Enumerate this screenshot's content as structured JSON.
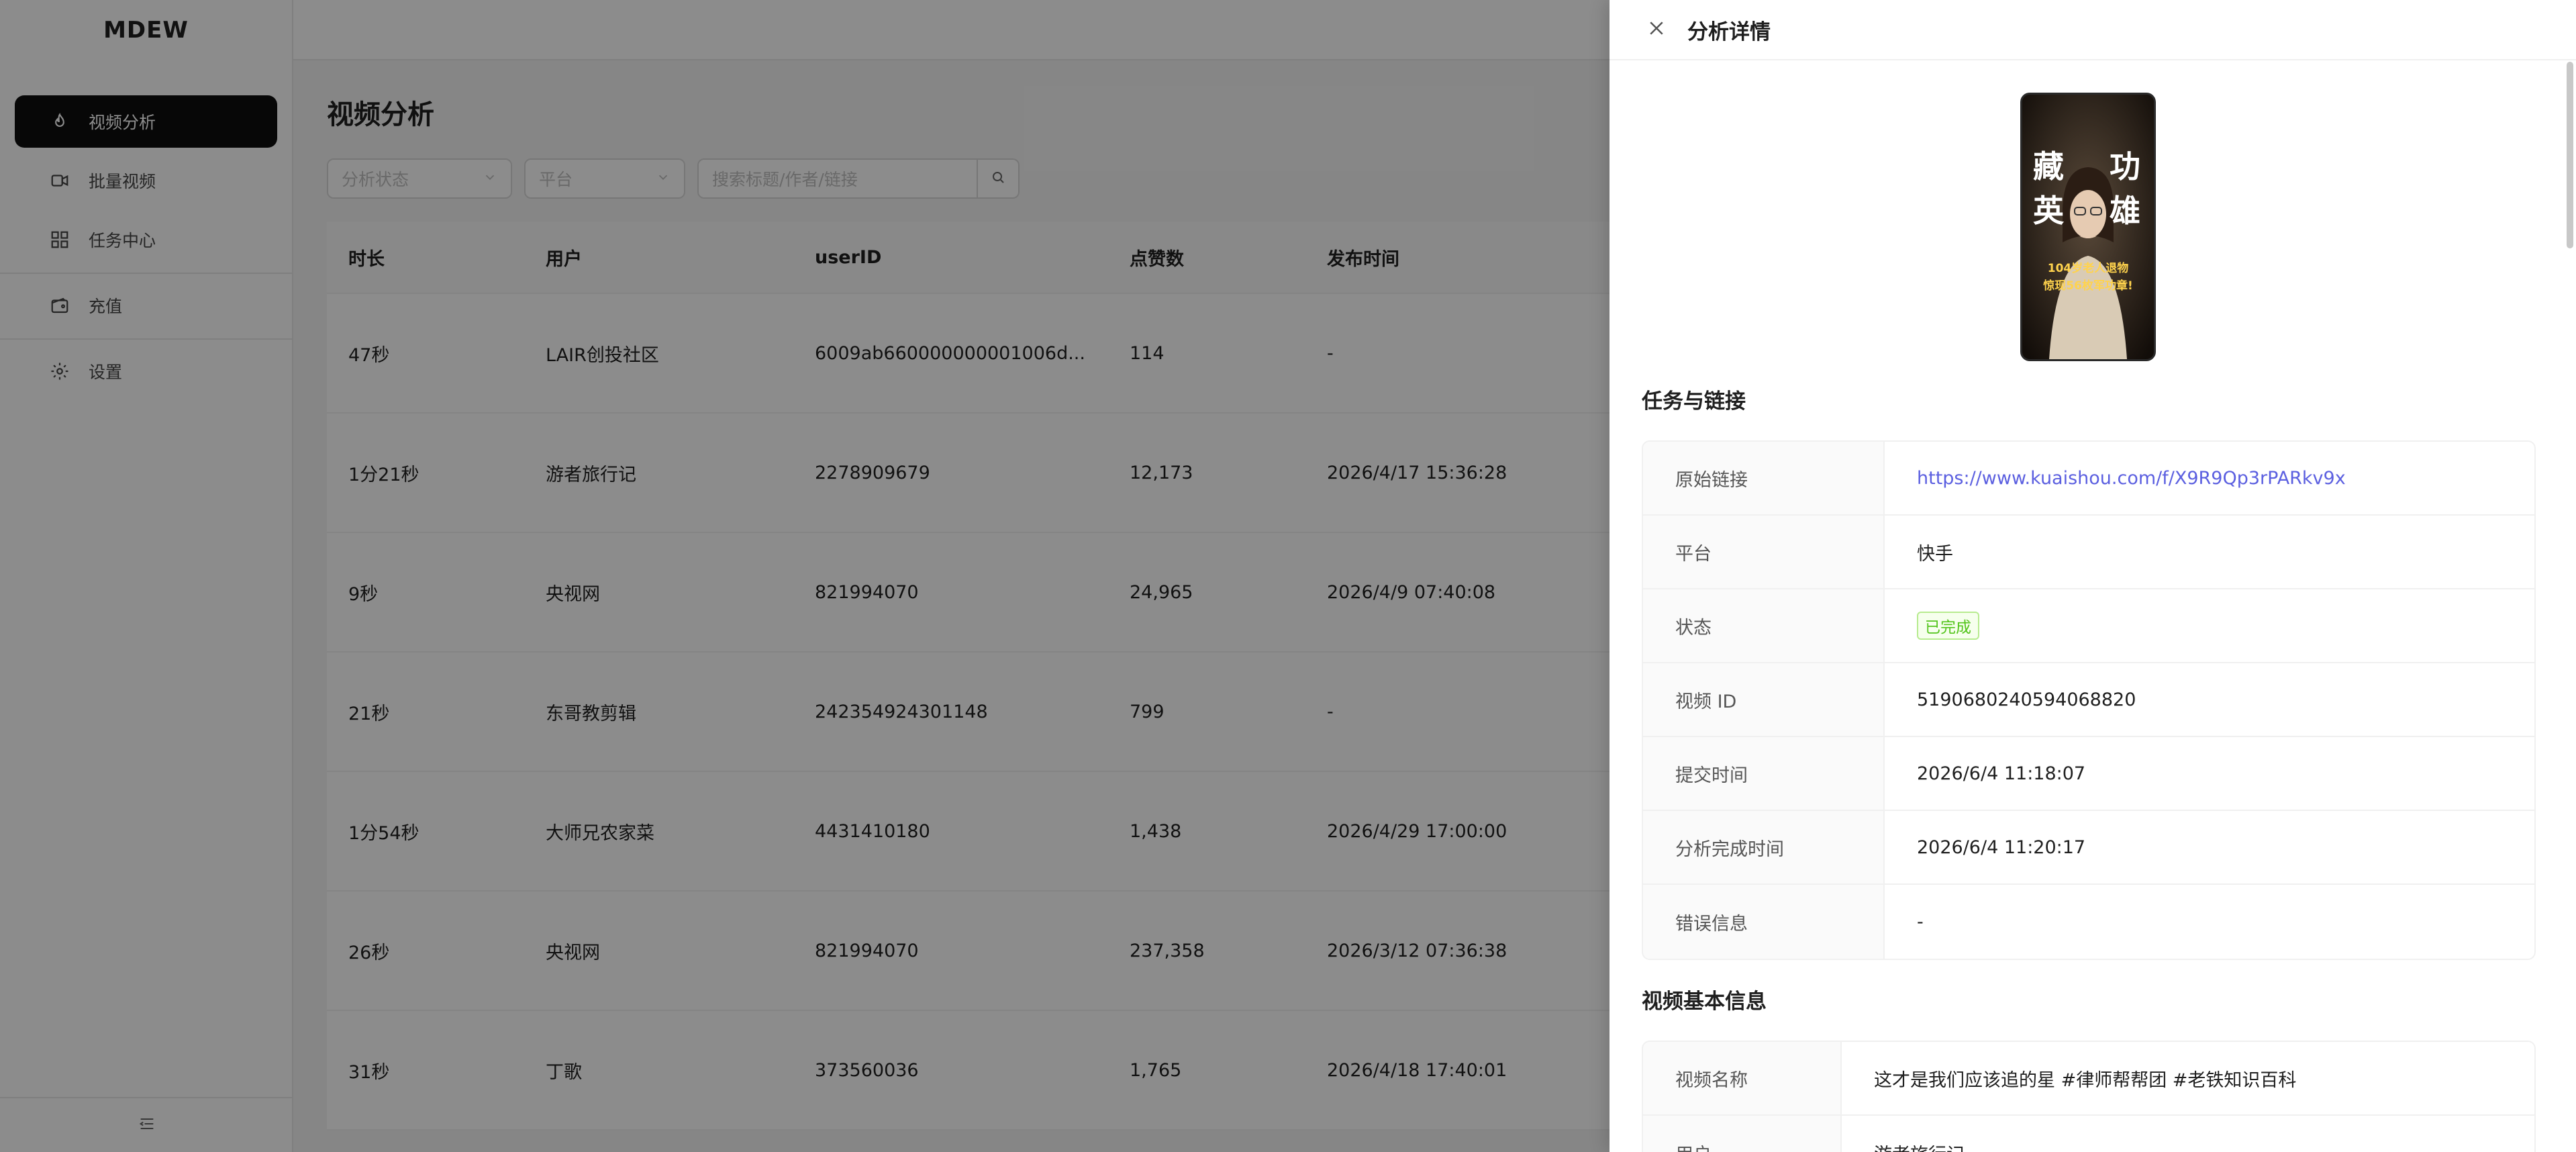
{
  "app": {
    "logo": "MDEW"
  },
  "sidebar": {
    "items": [
      {
        "label": "视频分析",
        "icon": "flame-icon",
        "active": true
      },
      {
        "label": "批量视频",
        "icon": "video-camera-icon"
      },
      {
        "label": "任务中心",
        "icon": "grid-icon"
      },
      {
        "label": "充值",
        "icon": "wallet-icon"
      },
      {
        "label": "设置",
        "icon": "gear-icon"
      }
    ],
    "collapse_icon": "menu-fold-icon"
  },
  "main": {
    "title": "视频分析",
    "filters": {
      "status_placeholder": "分析状态",
      "platform_placeholder": "平台",
      "search_placeholder": "搜索标题/作者/链接"
    },
    "table": {
      "columns": [
        "时长",
        "用户",
        "userID",
        "点赞数",
        "发布时间"
      ],
      "rows": [
        [
          "47秒",
          "LAIR创投社区",
          "6009ab660000000001006d...",
          "114",
          "-"
        ],
        [
          "1分21秒",
          "游者旅行记",
          "2278909679",
          "12,173",
          "2026/4/17 15:36:28"
        ],
        [
          "9秒",
          "央视网",
          "821994070",
          "24,965",
          "2026/4/9 07:40:08"
        ],
        [
          "21秒",
          "东哥教剪辑",
          "242354924301148",
          "799",
          "-"
        ],
        [
          "1分54秒",
          "大师兄农家菜",
          "4431410180",
          "1,438",
          "2026/4/29 17:00:00"
        ],
        [
          "26秒",
          "央视网",
          "821994070",
          "237,358",
          "2026/3/12 07:36:38"
        ],
        [
          "31秒",
          "丁歌",
          "373560036",
          "1,765",
          "2026/4/18 17:40:01"
        ]
      ]
    }
  },
  "drawer": {
    "title": "分析详情",
    "thumbnail": {
      "text_left": "藏英",
      "text_right": "功雄",
      "caption_line1": "104岁老人退物",
      "caption_line2": "惊现56枚军功章!"
    },
    "section1": {
      "title": "任务与链接",
      "rows": [
        {
          "label": "原始链接",
          "value": "https://www.kuaishou.com/f/X9R9Qp3rPARkv9x"
        },
        {
          "label": "平台",
          "value": "快手"
        },
        {
          "label": "状态",
          "value": "已完成"
        },
        {
          "label": "视频 ID",
          "value": "5190680240594068820"
        },
        {
          "label": "提交时间",
          "value": "2026/6/4 11:18:07"
        },
        {
          "label": "分析完成时间",
          "value": "2026/6/4 11:20:17"
        },
        {
          "label": "错误信息",
          "value": "-"
        }
      ]
    },
    "section2": {
      "title": "视频基本信息",
      "rows": [
        {
          "label": "视频名称",
          "value": "这才是我们应该追的星 #律师帮帮团 #老铁知识百科"
        },
        {
          "label": "用户",
          "value": "游者旅行记"
        }
      ]
    }
  },
  "colors": {
    "accent": "#0d0d0d",
    "link": "#5b5fe0",
    "success": "#52c41a",
    "overlay": "rgba(0,0,0,0.45)"
  }
}
